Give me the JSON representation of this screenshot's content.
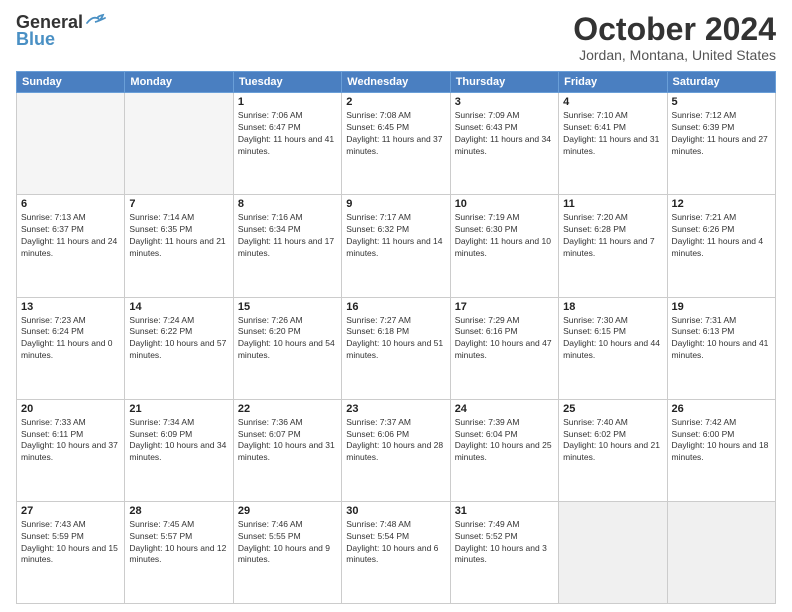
{
  "logo": {
    "line1": "General",
    "line2": "Blue"
  },
  "title": "October 2024",
  "subtitle": "Jordan, Montana, United States",
  "days_header": [
    "Sunday",
    "Monday",
    "Tuesday",
    "Wednesday",
    "Thursday",
    "Friday",
    "Saturday"
  ],
  "weeks": [
    [
      {
        "day": "",
        "info": ""
      },
      {
        "day": "",
        "info": ""
      },
      {
        "day": "1",
        "info": "Sunrise: 7:06 AM\nSunset: 6:47 PM\nDaylight: 11 hours and 41 minutes."
      },
      {
        "day": "2",
        "info": "Sunrise: 7:08 AM\nSunset: 6:45 PM\nDaylight: 11 hours and 37 minutes."
      },
      {
        "day": "3",
        "info": "Sunrise: 7:09 AM\nSunset: 6:43 PM\nDaylight: 11 hours and 34 minutes."
      },
      {
        "day": "4",
        "info": "Sunrise: 7:10 AM\nSunset: 6:41 PM\nDaylight: 11 hours and 31 minutes."
      },
      {
        "day": "5",
        "info": "Sunrise: 7:12 AM\nSunset: 6:39 PM\nDaylight: 11 hours and 27 minutes."
      }
    ],
    [
      {
        "day": "6",
        "info": "Sunrise: 7:13 AM\nSunset: 6:37 PM\nDaylight: 11 hours and 24 minutes."
      },
      {
        "day": "7",
        "info": "Sunrise: 7:14 AM\nSunset: 6:35 PM\nDaylight: 11 hours and 21 minutes."
      },
      {
        "day": "8",
        "info": "Sunrise: 7:16 AM\nSunset: 6:34 PM\nDaylight: 11 hours and 17 minutes."
      },
      {
        "day": "9",
        "info": "Sunrise: 7:17 AM\nSunset: 6:32 PM\nDaylight: 11 hours and 14 minutes."
      },
      {
        "day": "10",
        "info": "Sunrise: 7:19 AM\nSunset: 6:30 PM\nDaylight: 11 hours and 10 minutes."
      },
      {
        "day": "11",
        "info": "Sunrise: 7:20 AM\nSunset: 6:28 PM\nDaylight: 11 hours and 7 minutes."
      },
      {
        "day": "12",
        "info": "Sunrise: 7:21 AM\nSunset: 6:26 PM\nDaylight: 11 hours and 4 minutes."
      }
    ],
    [
      {
        "day": "13",
        "info": "Sunrise: 7:23 AM\nSunset: 6:24 PM\nDaylight: 11 hours and 0 minutes."
      },
      {
        "day": "14",
        "info": "Sunrise: 7:24 AM\nSunset: 6:22 PM\nDaylight: 10 hours and 57 minutes."
      },
      {
        "day": "15",
        "info": "Sunrise: 7:26 AM\nSunset: 6:20 PM\nDaylight: 10 hours and 54 minutes."
      },
      {
        "day": "16",
        "info": "Sunrise: 7:27 AM\nSunset: 6:18 PM\nDaylight: 10 hours and 51 minutes."
      },
      {
        "day": "17",
        "info": "Sunrise: 7:29 AM\nSunset: 6:16 PM\nDaylight: 10 hours and 47 minutes."
      },
      {
        "day": "18",
        "info": "Sunrise: 7:30 AM\nSunset: 6:15 PM\nDaylight: 10 hours and 44 minutes."
      },
      {
        "day": "19",
        "info": "Sunrise: 7:31 AM\nSunset: 6:13 PM\nDaylight: 10 hours and 41 minutes."
      }
    ],
    [
      {
        "day": "20",
        "info": "Sunrise: 7:33 AM\nSunset: 6:11 PM\nDaylight: 10 hours and 37 minutes."
      },
      {
        "day": "21",
        "info": "Sunrise: 7:34 AM\nSunset: 6:09 PM\nDaylight: 10 hours and 34 minutes."
      },
      {
        "day": "22",
        "info": "Sunrise: 7:36 AM\nSunset: 6:07 PM\nDaylight: 10 hours and 31 minutes."
      },
      {
        "day": "23",
        "info": "Sunrise: 7:37 AM\nSunset: 6:06 PM\nDaylight: 10 hours and 28 minutes."
      },
      {
        "day": "24",
        "info": "Sunrise: 7:39 AM\nSunset: 6:04 PM\nDaylight: 10 hours and 25 minutes."
      },
      {
        "day": "25",
        "info": "Sunrise: 7:40 AM\nSunset: 6:02 PM\nDaylight: 10 hours and 21 minutes."
      },
      {
        "day": "26",
        "info": "Sunrise: 7:42 AM\nSunset: 6:00 PM\nDaylight: 10 hours and 18 minutes."
      }
    ],
    [
      {
        "day": "27",
        "info": "Sunrise: 7:43 AM\nSunset: 5:59 PM\nDaylight: 10 hours and 15 minutes."
      },
      {
        "day": "28",
        "info": "Sunrise: 7:45 AM\nSunset: 5:57 PM\nDaylight: 10 hours and 12 minutes."
      },
      {
        "day": "29",
        "info": "Sunrise: 7:46 AM\nSunset: 5:55 PM\nDaylight: 10 hours and 9 minutes."
      },
      {
        "day": "30",
        "info": "Sunrise: 7:48 AM\nSunset: 5:54 PM\nDaylight: 10 hours and 6 minutes."
      },
      {
        "day": "31",
        "info": "Sunrise: 7:49 AM\nSunset: 5:52 PM\nDaylight: 10 hours and 3 minutes."
      },
      {
        "day": "",
        "info": ""
      },
      {
        "day": "",
        "info": ""
      }
    ]
  ]
}
